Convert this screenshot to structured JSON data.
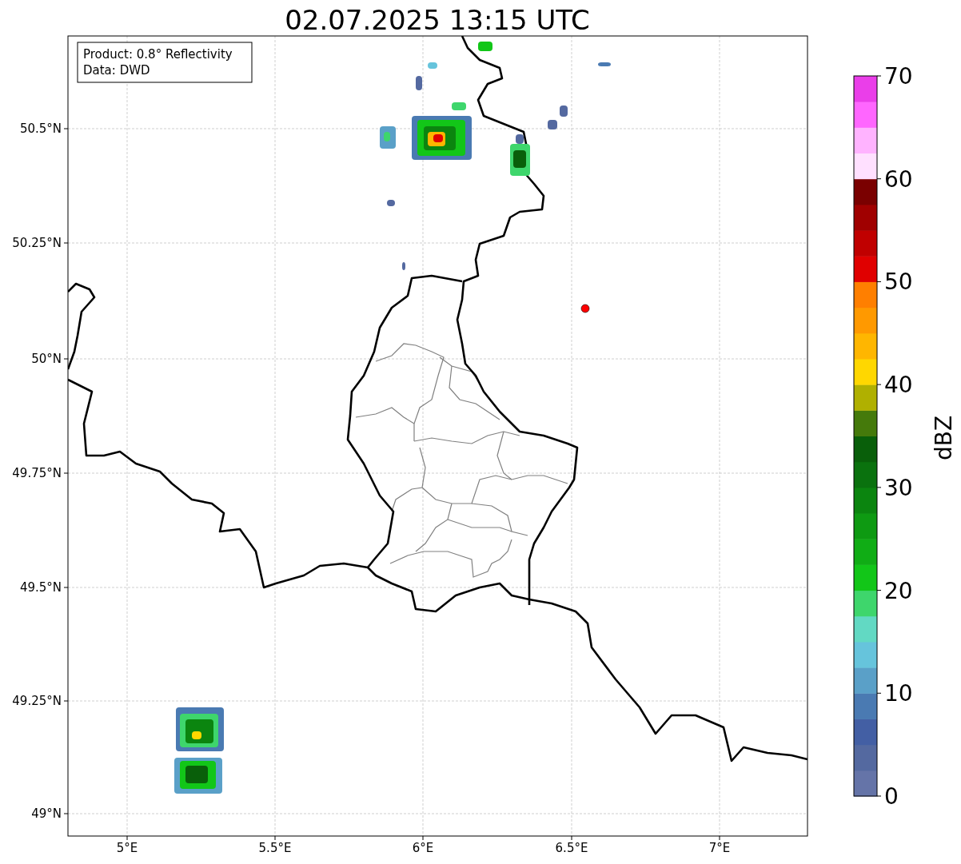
{
  "title": "02.07.2025 13:15 UTC",
  "info_box": {
    "lines": [
      "Product: 0.8° Reflectivity",
      "Data: DWD"
    ]
  },
  "map": {
    "x_ticks": [
      "5°E",
      "5.5°E",
      "6°E",
      "6.5°E",
      "7°E"
    ],
    "y_ticks": [
      "50.5°N",
      "50.25°N",
      "50°N",
      "49.75°N",
      "49.5°N",
      "49.25°N",
      "49°N"
    ]
  },
  "colorbar": {
    "label": "dBZ",
    "ticks": [
      "70",
      "60",
      "50",
      "40",
      "30",
      "20",
      "10",
      "0"
    ],
    "bins": [
      {
        "color": "#6574a8"
      },
      {
        "color": "#5469a0"
      },
      {
        "color": "#435fa4"
      },
      {
        "color": "#4a7ab2"
      },
      {
        "color": "#5aa0c8"
      },
      {
        "color": "#66c4dc"
      },
      {
        "color": "#62d9c3"
      },
      {
        "color": "#3ed66c"
      },
      {
        "color": "#12c618"
      },
      {
        "color": "#10ad15"
      },
      {
        "color": "#0e9a12"
      },
      {
        "color": "#0b850f"
      },
      {
        "color": "#0a720e"
      },
      {
        "color": "#095f0a"
      },
      {
        "color": "#457a0b"
      },
      {
        "color": "#b0b000"
      },
      {
        "color": "#ffd700"
      },
      {
        "color": "#ffb600"
      },
      {
        "color": "#ff9900"
      },
      {
        "color": "#ff7f00"
      },
      {
        "color": "#e00000"
      },
      {
        "color": "#c00000"
      },
      {
        "color": "#a00000"
      },
      {
        "color": "#7a0000"
      },
      {
        "color": "#ffe0ff"
      },
      {
        "color": "#ffb3ff"
      },
      {
        "color": "#ff66ff"
      },
      {
        "color": "#ea3ee9"
      }
    ]
  }
}
